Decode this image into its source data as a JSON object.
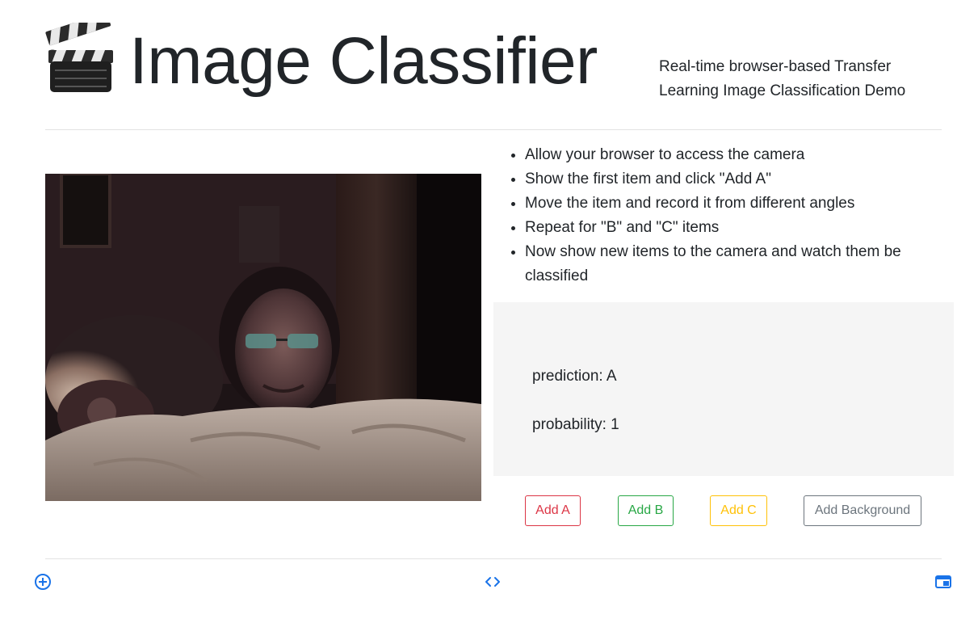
{
  "header": {
    "logo_icon": "clapperboard-icon",
    "title": "Image Classifier",
    "subtitle": "Real-time browser-based Transfer Learning Image Classification Demo"
  },
  "webcam": {
    "content": "live-camera-feed"
  },
  "instructions": [
    "Allow your browser to access the camera",
    "Show the first item and click \"Add A\"",
    "Move the item and record it from different angles",
    "Repeat for \"B\" and \"C\" items",
    "Now show new items to the camera and watch them be classified"
  ],
  "result": {
    "prediction": "prediction: A",
    "probability": "probability: 1"
  },
  "buttons": {
    "add_a": "Add A",
    "add_b": "Add B",
    "add_c": "Add C",
    "add_background": "Add Background"
  },
  "colors": {
    "add_a": "#dc3545",
    "add_b": "#28a745",
    "add_c": "#ffc107",
    "add_background": "#6c757d",
    "footer_icons": "#1a73e8"
  },
  "footer": {
    "left_icon": "plus-circle-icon",
    "center_icon": "code-icon",
    "right_icon": "browser-window-icon"
  }
}
